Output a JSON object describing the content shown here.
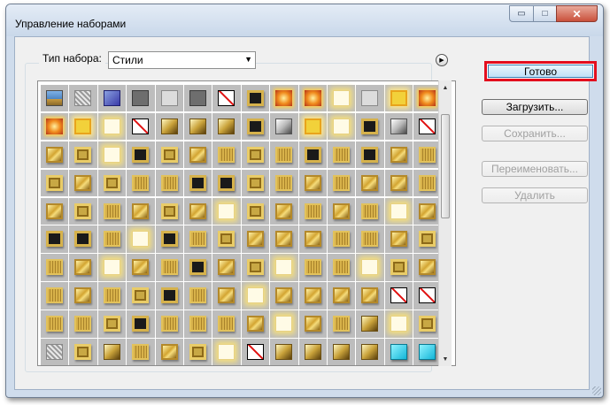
{
  "window": {
    "title": "Управление наборами",
    "minimize_glyph": "▭",
    "maximize_glyph": "□",
    "close_glyph": "✕"
  },
  "preset": {
    "type_label": "Тип набора:",
    "type_value": "Стили",
    "dropdown_glyph": "▼",
    "menu_glyph": "▶"
  },
  "buttons": {
    "done": "Готово",
    "load": "Загрузить...",
    "save": "Сохранить...",
    "rename": "Переименовать...",
    "delete": "Удалить"
  },
  "scrollbar": {
    "up_glyph": "▲",
    "down_glyph": "▼"
  },
  "styles_grid": [
    [
      "sky",
      "noise",
      "blue",
      "gray",
      "light",
      "gray",
      "none",
      "dark",
      "fire",
      "fire",
      "whiteglow",
      "light",
      "glow",
      "fire"
    ],
    [
      "fire",
      "glow",
      "whiteglow",
      "none",
      "goldbevel",
      "goldbevel",
      "goldbevel",
      "dark",
      "bevel",
      "glow",
      "whiteglow",
      "dark",
      "bevel",
      "none"
    ],
    [
      "gold",
      "frame",
      "whiteglow",
      "dark",
      "frame",
      "gold",
      "tex",
      "frame",
      "tex",
      "dark",
      "tex",
      "dark",
      "gold",
      "tex"
    ],
    [
      "frame",
      "gold",
      "frame",
      "tex",
      "tex",
      "dark",
      "dark",
      "frame",
      "tex",
      "gold",
      "tex",
      "gold",
      "gold",
      "tex"
    ],
    [
      "gold",
      "frame",
      "tex",
      "gold",
      "frame",
      "gold",
      "whiteglow",
      "frame",
      "gold",
      "tex",
      "gold",
      "tex",
      "whiteglow",
      "gold"
    ],
    [
      "dark",
      "dark",
      "tex",
      "whiteglow",
      "dark",
      "tex",
      "frame",
      "gold",
      "gold",
      "gold",
      "tex",
      "tex",
      "gold",
      "frame"
    ],
    [
      "tex",
      "gold",
      "whiteglow",
      "gold",
      "tex",
      "dark",
      "gold",
      "frame",
      "whiteglow",
      "tex",
      "tex",
      "whiteglow",
      "frame",
      "gold"
    ],
    [
      "tex",
      "gold",
      "tex",
      "frame",
      "dark",
      "tex",
      "gold",
      "whiteglow",
      "gold",
      "gold",
      "gold",
      "gold",
      "none",
      "none"
    ],
    [
      "tex",
      "tex",
      "frame",
      "dark",
      "tex",
      "tex",
      "tex",
      "gold",
      "whiteglow",
      "gold",
      "tex",
      "goldbevel",
      "whiteglow",
      "frame"
    ],
    [
      "noise",
      "frame",
      "goldbevel",
      "tex",
      "gold",
      "frame",
      "whiteglow",
      "none",
      "goldbevel",
      "goldbevel",
      "goldbevel",
      "goldbevel",
      "cyan",
      "cyan"
    ]
  ]
}
